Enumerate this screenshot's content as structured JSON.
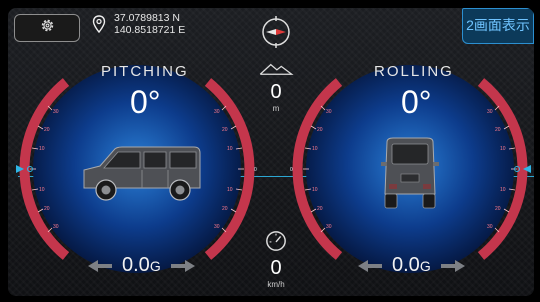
{
  "header": {
    "latitude": "37.0789813 N",
    "longitude": "140.8518721 E",
    "two_screen_label": "2画面表示",
    "icons": [
      "gear-icon",
      "location-pin-icon",
      "compass-icon"
    ]
  },
  "altitude": {
    "value": "0",
    "unit": "m",
    "icon": "mountain-icon"
  },
  "speed": {
    "value": "0",
    "unit": "km/h",
    "icon": "speedometer-icon"
  },
  "pitching": {
    "title": "PITCHING",
    "angle": "0°",
    "g_value": "0.0",
    "g_unit": "G"
  },
  "rolling": {
    "title": "ROLLING",
    "angle": "0°",
    "g_value": "0.0",
    "g_unit": "G"
  },
  "scale": {
    "labels": [
      "10",
      "20",
      "30",
      "40",
      "50",
      "60",
      "70"
    ],
    "center_label": "0"
  },
  "colors": {
    "accent_blue": "#2fb6e6",
    "scale_red": "#d8394f",
    "panel_blue": "#0c3a5a"
  }
}
